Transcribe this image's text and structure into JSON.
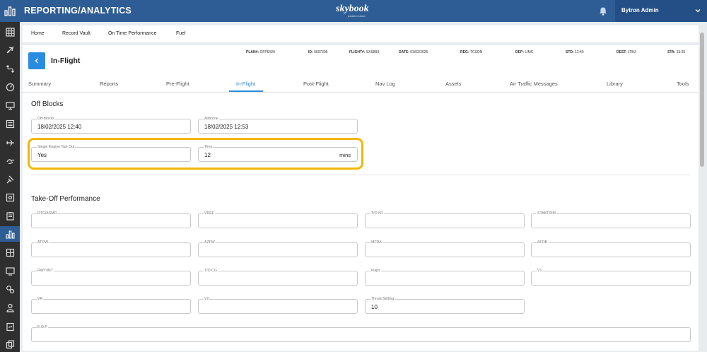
{
  "header": {
    "title": "REPORTING/ANALYTICS",
    "brand": "skybook",
    "brand_sub": "aviation cloud",
    "user": "Bytron Admin"
  },
  "sidebar": {
    "icons": [
      "grid-icon",
      "plane-icon",
      "route-icon",
      "gauge-icon",
      "monitor-icon",
      "list-icon",
      "plane-alt-icon",
      "bird-icon",
      "pin-icon",
      "camera-icon",
      "clipboard-icon",
      "chart-icon",
      "table-icon",
      "display-icon",
      "gears-icon",
      "person-icon",
      "report-icon",
      "copy-icon"
    ]
  },
  "nav": {
    "home": "Home",
    "record_vault": "Record Vault",
    "on_time": "On Time Performance",
    "fuel": "Fuel"
  },
  "flight": {
    "title": "In-Flight",
    "plan": {
      "label": "PLAN#:",
      "value": "OFP6/0/0"
    },
    "id": {
      "label": "ID:",
      "value": "5697305"
    },
    "flight": {
      "label": "FLIGHT#:",
      "value": "SXS893"
    },
    "date": {
      "label": "DATE:",
      "value": "03/02/2025"
    },
    "reg": {
      "label": "REG:",
      "value": "TCSON"
    },
    "dep": {
      "label": "DEP:",
      "value": "LIMC"
    },
    "std": {
      "label": "STD:",
      "value": "12:40"
    },
    "dest": {
      "label": "DEST:",
      "value": "LTBJ"
    },
    "sta": {
      "label": "STA:",
      "value": "15:25"
    }
  },
  "tabs": [
    "Summary",
    "Reports",
    "Pre-Flight",
    "In-Flight",
    "Post-Flight",
    "Nav Log",
    "Assets",
    "Air Traffic Messages",
    "Library",
    "Tools"
  ],
  "off_blocks": {
    "title": "Off Blocks",
    "off_blocks_label": "Off-Blocks",
    "off_blocks_value": "18/02/2025 12:40",
    "airborne_label": "Airborne",
    "airborne_value": "18/02/2025 12:53",
    "se_taxi_label": "Single Engine Taxi Out",
    "se_taxi_value": "Yes",
    "time_label": "Time",
    "time_value": "12",
    "time_unit": "mins"
  },
  "takeoff": {
    "title": "Take-Off Performance",
    "fields": {
      "rtg": {
        "label": "RTG/ASMD",
        "value": ""
      },
      "vref": {
        "label": "VREF",
        "value": ""
      },
      "ton1": {
        "label": "T/O N1",
        "value": ""
      },
      "stabtrim": {
        "label": "STABTRIM",
        "value": ""
      },
      "atow": {
        "label": "ATOW",
        "value": ""
      },
      "azfw": {
        "label": "AZFW",
        "value": ""
      },
      "mfra": {
        "label": "MFRA",
        "value": ""
      },
      "afob": {
        "label": "AFOB",
        "value": ""
      },
      "rwy": {
        "label": "RWY/INT",
        "value": ""
      },
      "tocg": {
        "label": "T/O CG",
        "value": ""
      },
      "flaps": {
        "label": "Flaps",
        "value": ""
      },
      "v1": {
        "label": "V1",
        "value": ""
      },
      "vr": {
        "label": "VR",
        "value": ""
      },
      "v2": {
        "label": "V2",
        "value": ""
      },
      "thrust": {
        "label": "Thrust Setting",
        "value": "10"
      },
      "eop": {
        "label": "E.O.P",
        "value": ""
      }
    }
  },
  "colors": {
    "header": "#2e5d95",
    "accent": "#2a8ce0",
    "highlight": "#f2b705",
    "sidebar": "#2f2f2f"
  }
}
